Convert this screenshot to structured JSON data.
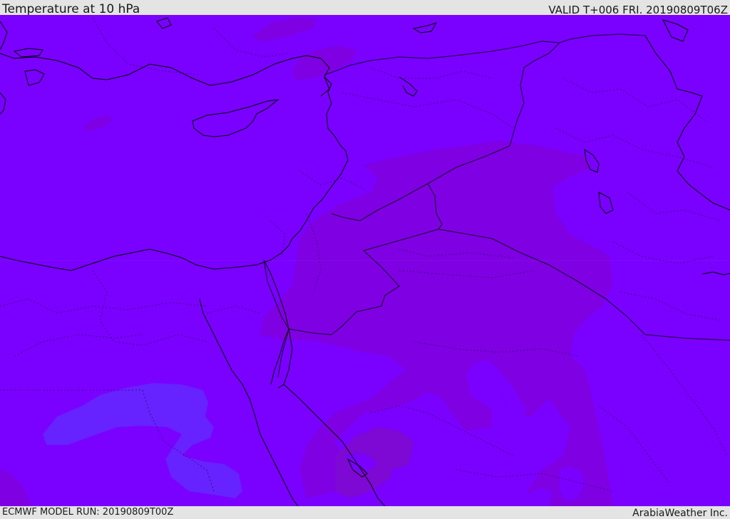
{
  "header": {
    "title": "Temperature at 10 hPa",
    "valid": "VALID T+006 FRI. 20190809T06Z"
  },
  "footer": {
    "model_run": "ECMWF MODEL RUN: 20190809T00Z",
    "credit": "ArabiaWeather Inc."
  },
  "map": {
    "field": "temperature",
    "colors": {
      "base": "#7a00ff",
      "warmer": "#7f00e2",
      "warm_patch": "#7e08d4",
      "cooler": "#6622ff",
      "coastline": "#000000",
      "border": "#1a0033",
      "admin_border": "#3a0070"
    }
  }
}
